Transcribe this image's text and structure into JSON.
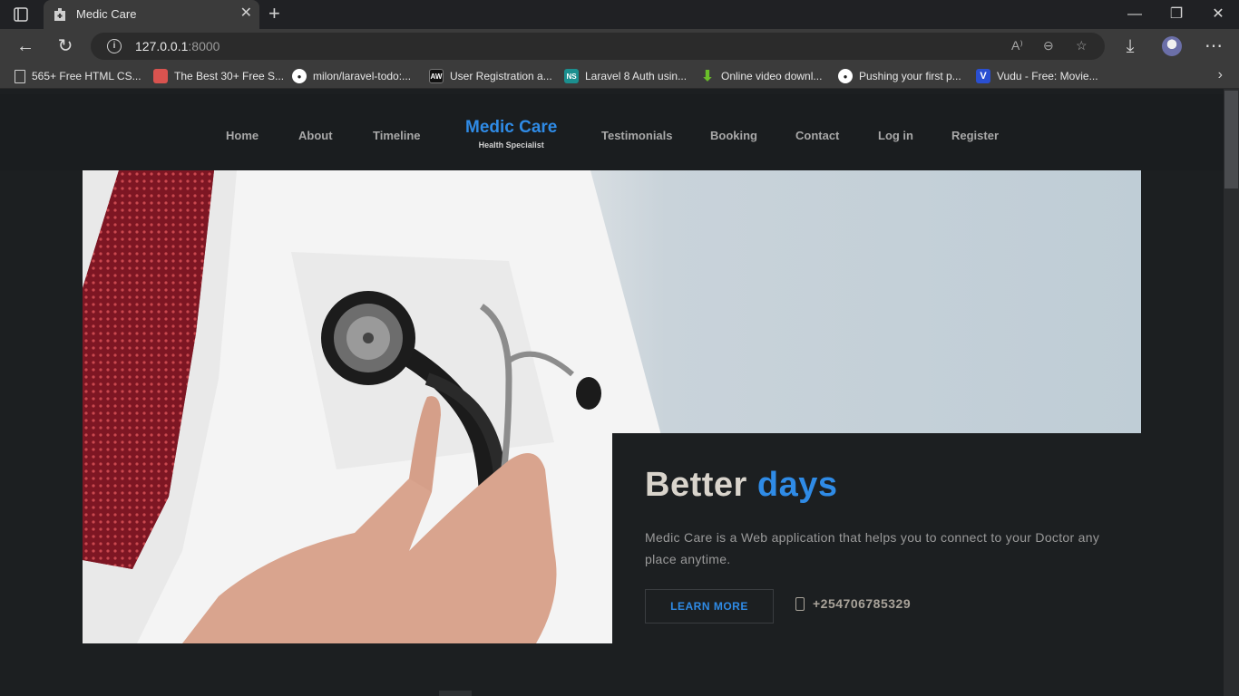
{
  "browser": {
    "tab_title": "Medic Care",
    "url_host": "127.0.0.1",
    "url_port": ":8000",
    "bookmarks": [
      {
        "label": "565+ Free HTML CS...",
        "icon": "page-icon",
        "color": "#e0e0e0"
      },
      {
        "label": "The Best 30+ Free S...",
        "icon": "bookmark-icon-red",
        "color": "#d9534f"
      },
      {
        "label": "milon/laravel-todo:...",
        "icon": "github-icon",
        "color": "#ffffff"
      },
      {
        "label": "User Registration a...",
        "icon": "aw-icon",
        "color": "#111111"
      },
      {
        "label": "Laravel 8 Auth usin...",
        "icon": "ns-icon",
        "color": "#1b8f8f"
      },
      {
        "label": "Online video downl...",
        "icon": "download-arrow-icon",
        "color": "#6abf2a"
      },
      {
        "label": "Pushing your first p...",
        "icon": "github-icon",
        "color": "#ffffff"
      },
      {
        "label": "Vudu - Free: Movie...",
        "icon": "vudu-icon",
        "color": "#2a4fd1"
      }
    ]
  },
  "site": {
    "nav_left": [
      "Home",
      "About",
      "Timeline"
    ],
    "nav_right": [
      "Testimonials",
      "Booking",
      "Contact",
      "Log in",
      "Register"
    ],
    "brand_name": "Medic Care",
    "brand_sub": "Health Specialist",
    "accent_color": "#2f8be6"
  },
  "hero": {
    "title_main": "Better",
    "title_accent": "days",
    "description": "Medic Care is a Web application that helps you to connect to your Doctor any place anytime.",
    "button_label": "LEARN MORE",
    "phone": "+254706785329"
  }
}
